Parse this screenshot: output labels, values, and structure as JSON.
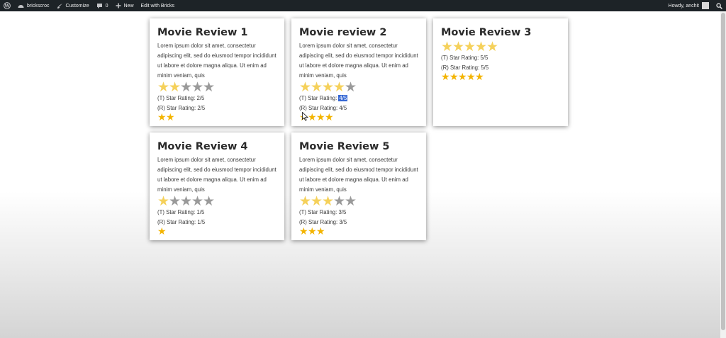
{
  "adminbar": {
    "site_name": "brickscroc",
    "customize": "Customize",
    "comments_count": "0",
    "new_label": "New",
    "edit_with": "Edit with Bricks",
    "howdy": "Howdy, anchit"
  },
  "cards": [
    {
      "title": "Movie Review 1",
      "body": "Lorem ipsum dolor sit amet, consectetur adipiscing elit, sed do eiusmod tempor incididunt ut labore et dolore magna aliqua. Ut enim ad minim veniam, quis",
      "rating": 2,
      "max": 5,
      "t_label": "(T) Star Rating: ",
      "t_value": "2/5",
      "r_label": "(R) Star Rating: ",
      "r_value": "2/5"
    },
    {
      "title": "Movie review 2",
      "body": "Lorem ipsum dolor sit amet, consectetur adipiscing elit, sed do eiusmod tempor incididunt ut labore et dolore magna aliqua. Ut enim ad minim veniam, quis",
      "rating": 4,
      "max": 5,
      "t_label": "(T) Star Rating: ",
      "t_value": "4/5",
      "r_label": "(R) Star Rating: ",
      "r_value": "4/5"
    },
    {
      "title": "Movie Review 3",
      "body": "",
      "rating": 5,
      "max": 5,
      "t_label": "(T) Star Rating: ",
      "t_value": "5/5",
      "r_label": "(R) Star Rating: ",
      "r_value": "5/5"
    },
    {
      "title": "Movie Review 4",
      "body": "Lorem ipsum dolor sit amet, consectetur adipiscing elit, sed do eiusmod tempor incididunt ut labore et dolore magna aliqua. Ut enim ad minim veniam, quis",
      "rating": 1,
      "max": 5,
      "t_label": "(T) Star Rating: ",
      "t_value": "1/5",
      "r_label": "(R) Star Rating: ",
      "r_value": "1/5"
    },
    {
      "title": "Movie Review 5",
      "body": "Lorem ipsum dolor sit amet, consectetur adipiscing elit, sed do eiusmod tempor incididunt ut labore et dolore magna aliqua. Ut enim ad minim veniam, quis",
      "rating": 3,
      "max": 5,
      "t_label": "(T) Star Rating: ",
      "t_value": "3/5",
      "r_label": "(R) Star Rating: ",
      "r_value": "3/5"
    }
  ],
  "colors": {
    "star_filled": "#f5d15b",
    "star_empty": "#9a9a9a",
    "star_small": "#f3b400",
    "selection": "#3668d4",
    "adminbar_bg": "#1d2327"
  },
  "icons": [
    "wordpress-icon",
    "dashboard-icon",
    "brush-icon",
    "comment-icon",
    "plus-icon",
    "search-icon",
    "star-icon"
  ]
}
